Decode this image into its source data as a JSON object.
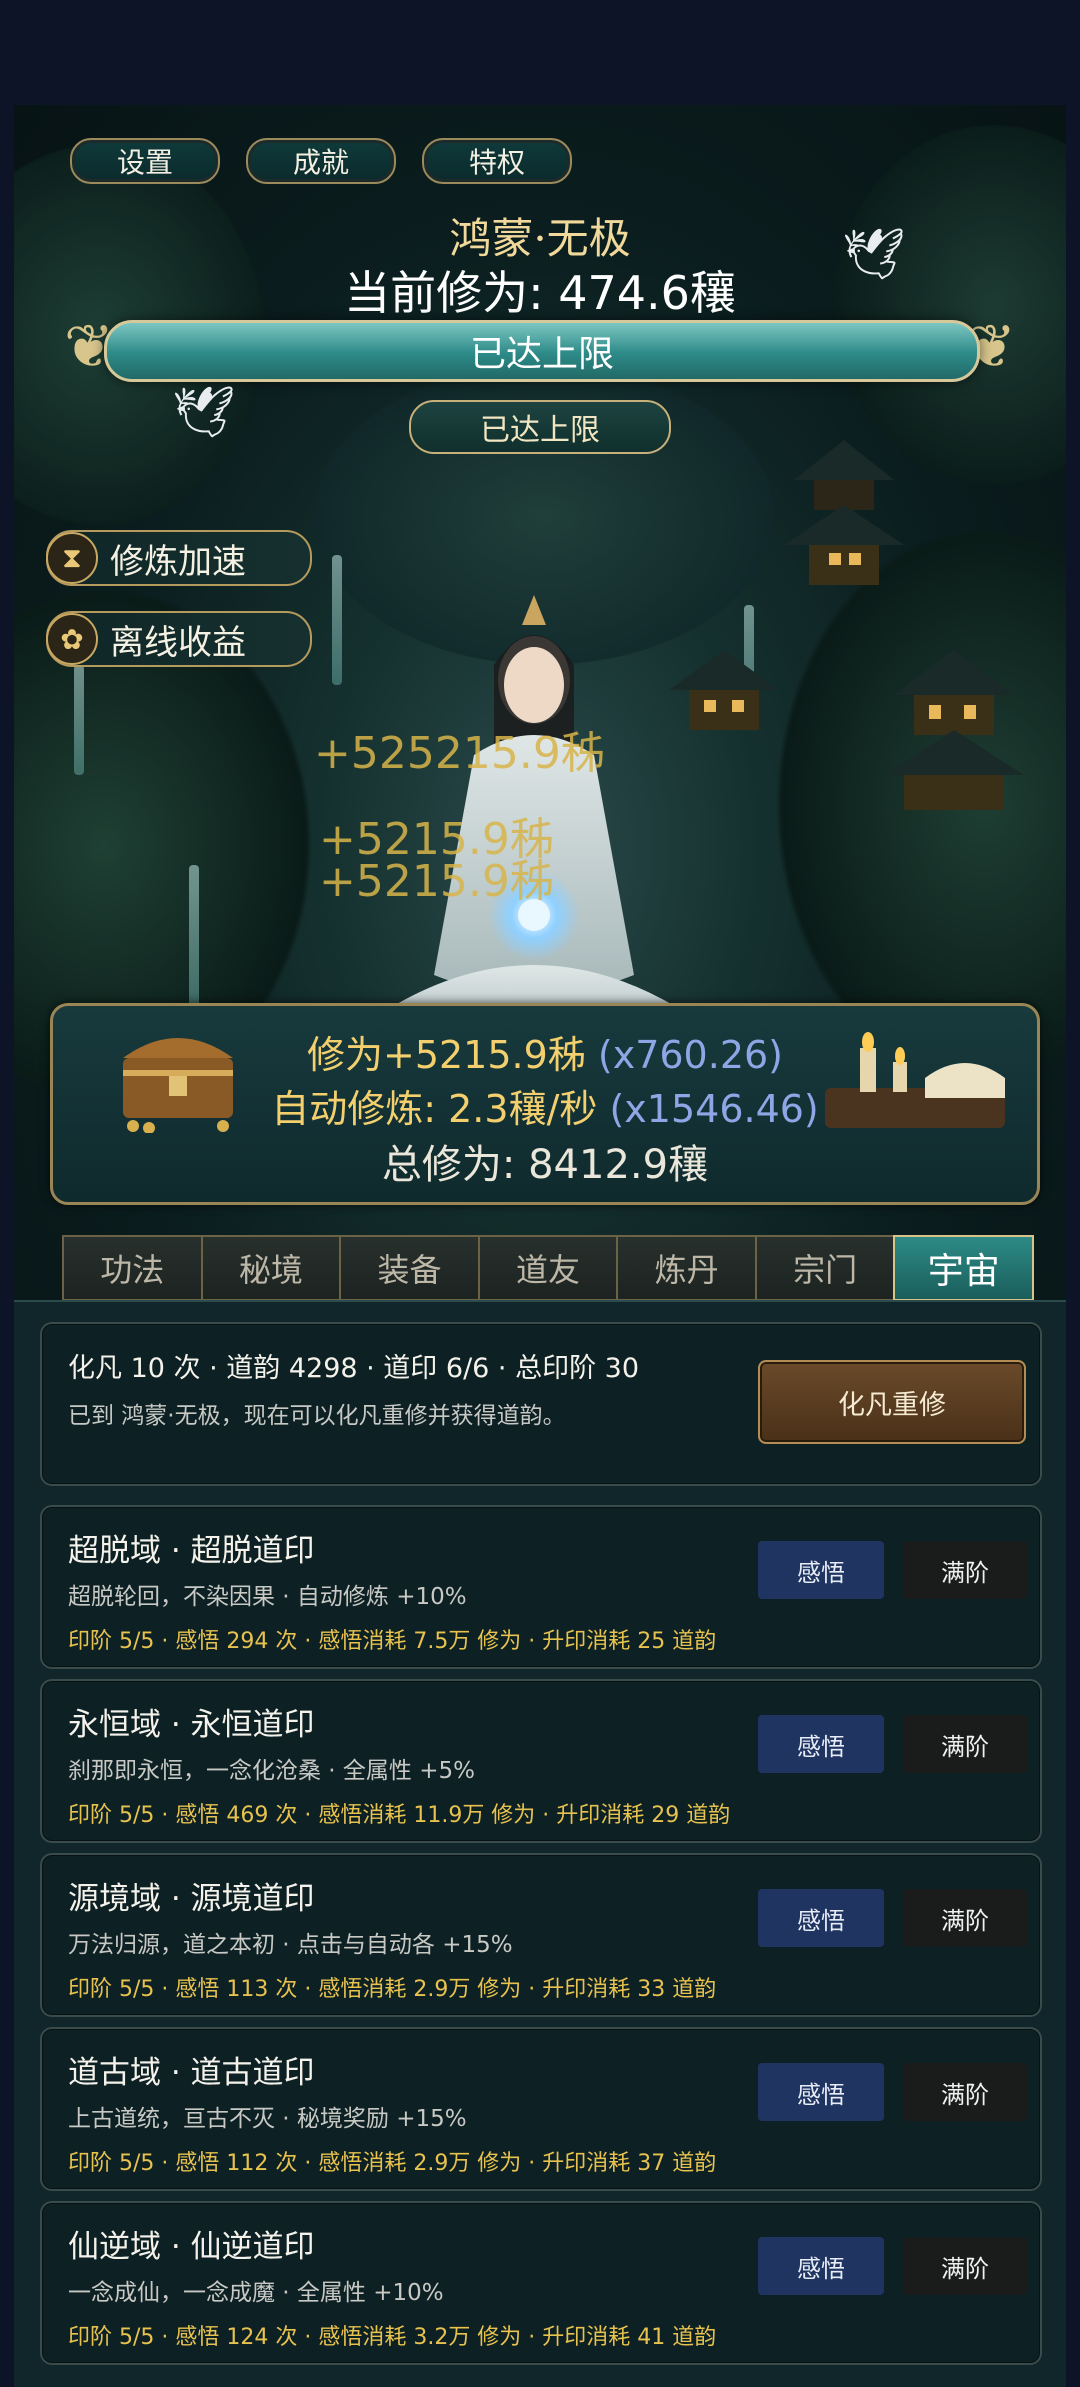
{
  "top_buttons": [
    "设置",
    "成就",
    "特权"
  ],
  "capsule": {
    "menu_icon": "more-dots-icon",
    "close_icon": "record-circle-icon"
  },
  "realm": "鸿蒙·无极",
  "cultivation": "当前修为: 474.6穰",
  "progress": {
    "label": "已达上限",
    "fraction": 1.0
  },
  "cap_button": "已达上限",
  "side_buttons": [
    {
      "icon": "hourglass-icon",
      "label": "修炼加速"
    },
    {
      "icon": "lotus-icon",
      "label": "离线收益"
    }
  ],
  "floating_texts": [
    "+525215.9秭",
    "+5215.9秭",
    "+5215.9秭"
  ],
  "gains": {
    "per_click": "修为+5215.9秭",
    "per_click_mult": "(x760.26)",
    "auto": "自动修炼: 2.3穰/秒",
    "auto_mult": "(x1546.46)",
    "total": "总修为: 8412.9穰"
  },
  "tabs": [
    "功法",
    "秘境",
    "装备",
    "道友",
    "炼丹",
    "宗门",
    "宇宙"
  ],
  "active_tab": "宇宙",
  "rebirth_card": {
    "summary": "化凡 10 次 · 道韵 4298 · 道印 6/6 · 总印阶 30",
    "desc": "已到 鸿蒙·无极，现在可以化凡重修并获得道韵。",
    "button": "化凡重修"
  },
  "domains": [
    {
      "title": "超脱域 · 超脱道印",
      "desc": "超脱轮回，不染因果 · 自动修炼 +10%",
      "stats": "印阶 5/5 · 感悟 294 次 · 感悟消耗 7.5万 修为 · 升印消耗 25 道韵",
      "btn_comprehend": "感悟",
      "btn_max": "满阶"
    },
    {
      "title": "永恒域 · 永恒道印",
      "desc": "刹那即永恒，一念化沧桑 · 全属性 +5%",
      "stats": "印阶 5/5 · 感悟 469 次 · 感悟消耗 11.9万 修为 · 升印消耗 29 道韵",
      "btn_comprehend": "感悟",
      "btn_max": "满阶"
    },
    {
      "title": "源境域 · 源境道印",
      "desc": "万法归源，道之本初 · 点击与自动各 +15%",
      "stats": "印阶 5/5 · 感悟 113 次 · 感悟消耗 2.9万 修为 · 升印消耗 33 道韵",
      "btn_comprehend": "感悟",
      "btn_max": "满阶"
    },
    {
      "title": "道古域 · 道古道印",
      "desc": "上古道统，亘古不灭 · 秘境奖励 +15%",
      "stats": "印阶 5/5 · 感悟 112 次 · 感悟消耗 2.9万 修为 · 升印消耗 37 道韵",
      "btn_comprehend": "感悟",
      "btn_max": "满阶"
    },
    {
      "title": "仙逆域 · 仙逆道印",
      "desc": "一念成仙，一念成魔 · 全属性 +10%",
      "stats": "印阶 5/5 · 感悟 124 次 · 感悟消耗 3.2万 修为 · 升印消耗 41 道韵",
      "btn_comprehend": "感悟",
      "btn_max": "满阶"
    }
  ]
}
